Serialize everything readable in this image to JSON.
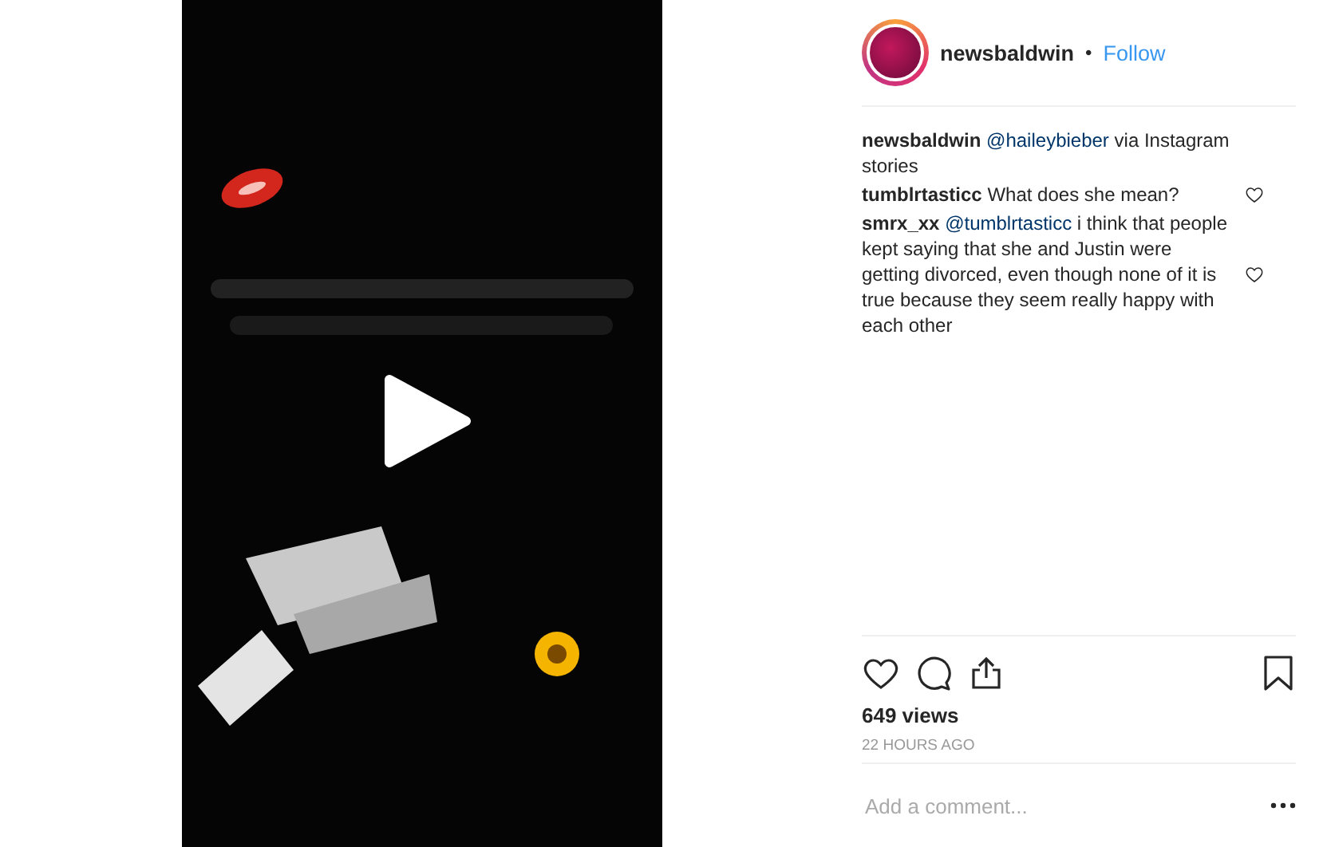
{
  "header": {
    "username": "newsbaldwin",
    "separator": "•",
    "follow": "Follow"
  },
  "comments": [
    {
      "user": "newsbaldwin",
      "mention": "@haileybieber",
      "rest": " via Instagram stories",
      "likeable": false
    },
    {
      "user": "tumblrtasticc",
      "rest": "What does she mean?",
      "likeable": true
    },
    {
      "user": "smrx_xx",
      "mention": "@tumblrtasticc",
      "rest": " i think that people kept saying that she and Justin were getting divorced, even though none of it is true because they seem really happy with each other",
      "likeable": true
    }
  ],
  "actions": {
    "liked": false,
    "saved": false
  },
  "views": "649 views",
  "time": "22 HOURS AGO",
  "comment_field": {
    "placeholder": "Add a comment..."
  }
}
